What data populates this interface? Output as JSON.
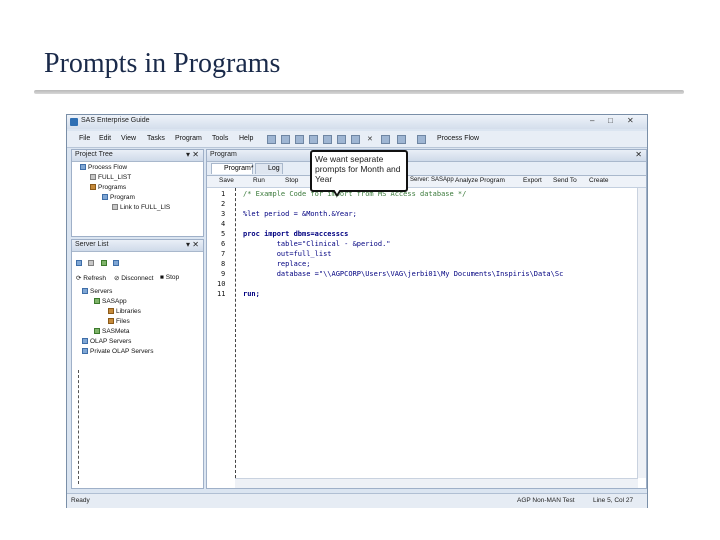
{
  "slide": {
    "title": "Prompts in Programs"
  },
  "window": {
    "title": "SAS Enterprise Guide",
    "controls": [
      "–",
      "□",
      "✕"
    ],
    "menu": [
      "File",
      "Edit",
      "View",
      "Tasks",
      "Program",
      "Tools",
      "Help"
    ],
    "toolbar_process": "Process Flow"
  },
  "project_tree": {
    "header": "Project Tree",
    "items": [
      "Process Flow",
      "FULL_LIST",
      "Programs",
      "Program",
      "Link to FULL_LIS"
    ]
  },
  "server_list": {
    "header": "Server List",
    "actions": [
      "Refresh",
      "Disconnect",
      "Stop"
    ],
    "items": [
      "Servers",
      "SASApp",
      "Libraries",
      "Files",
      "SASMeta",
      "OLAP Servers",
      "Private OLAP Servers"
    ]
  },
  "editor": {
    "header": "Program",
    "tabs": [
      "Program*",
      "Log"
    ],
    "toolbar": [
      "Save",
      "Run",
      "Stop",
      "Selected Server: SASApp",
      "Analyze Program",
      "Export",
      "Send To",
      "Create"
    ],
    "lines": [
      {
        "n": "1",
        "text": "/* Example Code for import from MS Access database */"
      },
      {
        "n": "2",
        "text": ""
      },
      {
        "n": "3",
        "text": "%let period = &Month.&Year;"
      },
      {
        "n": "4",
        "text": ""
      },
      {
        "n": "5",
        "text": "proc import dbms=accesscs"
      },
      {
        "n": "6",
        "text": "        table=\"Clinical - &period.\""
      },
      {
        "n": "7",
        "text": "        out=full_list"
      },
      {
        "n": "8",
        "text": "        replace;"
      },
      {
        "n": "9",
        "text": "        database =\"\\\\AGPCORP\\Users\\VAG\\jerbi01\\My Documents\\Inspiris\\Data\\Sc"
      },
      {
        "n": "10",
        "text": ""
      },
      {
        "n": "11",
        "text": "run;"
      }
    ]
  },
  "status": {
    "left": "Ready",
    "server": "AGP Non-MAN Test",
    "position": "Line 5, Col 27"
  },
  "callout": {
    "text": "We want separate prompts for Month and Year"
  }
}
